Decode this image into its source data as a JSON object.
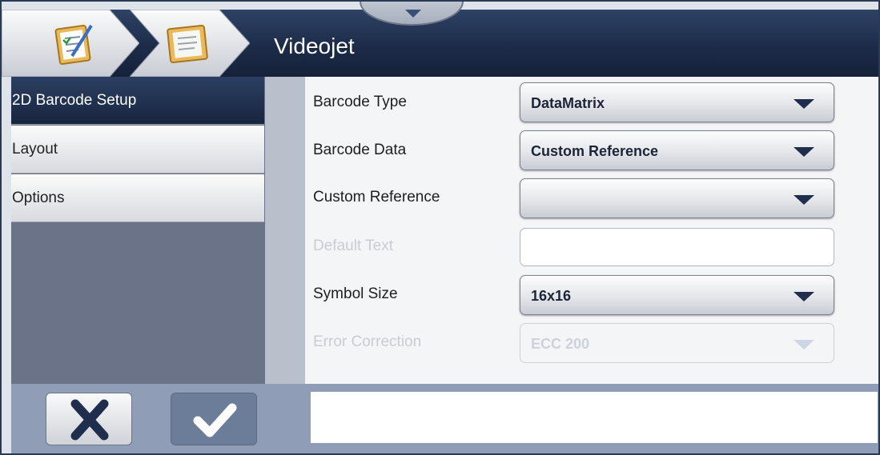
{
  "header": {
    "title": "Videojet",
    "breadcrumb": [
      {
        "icon": "clipboard-check-icon"
      },
      {
        "icon": "clipboard-icon"
      }
    ],
    "top_tab_icon": "chevron-down-icon"
  },
  "sidebar": {
    "items": [
      {
        "label": "2D Barcode Setup",
        "active": true
      },
      {
        "label": "Layout",
        "active": false
      },
      {
        "label": "Options",
        "active": false
      }
    ]
  },
  "form": {
    "barcode_type": {
      "label": "Barcode Type",
      "value": "DataMatrix"
    },
    "barcode_data": {
      "label": "Barcode Data",
      "value": "Custom Reference"
    },
    "custom_reference": {
      "label": "Custom Reference",
      "value": ""
    },
    "default_text": {
      "label": "Default Text",
      "value": ""
    },
    "symbol_size": {
      "label": "Symbol Size",
      "value": "16x16"
    },
    "error_correction": {
      "label": "Error Correction",
      "value": "ECC 200"
    }
  },
  "footer": {
    "cancel_icon": "close-icon",
    "confirm_icon": "check-icon",
    "message": ""
  },
  "colors": {
    "header_bg": "#1c2b48",
    "sidebar_bg": "#6b7389",
    "active_item": "#1f2e4d",
    "footer_bg": "#8f9db6",
    "disabled_text": "#c8ccd3"
  }
}
